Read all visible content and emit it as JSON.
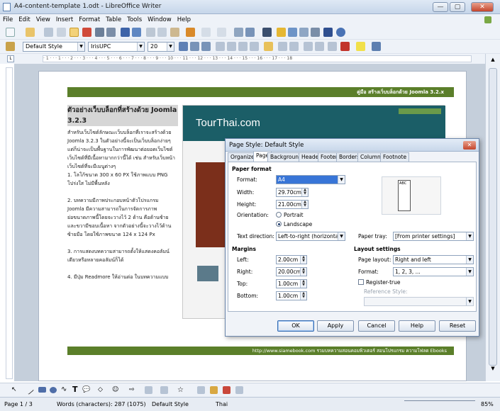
{
  "window": {
    "title": "A4-content-template 1.odt - LibreOffice Writer"
  },
  "menu": [
    "File",
    "Edit",
    "View",
    "Insert",
    "Format",
    "Table",
    "Tools",
    "Window",
    "Help"
  ],
  "format_toolbar": {
    "paragraph_style": "Default Style",
    "font_name": "IrisUPC",
    "font_size": "20"
  },
  "ruler": {
    "ticks": "· 1 · · · 1 · · · 2 · · · 3 · · · 4 · · · 5 · · · 6 · · · 7 · · · 8 · · · 9 · · · 10 · · · 11 · · · 12 · · · 13 · · · 14 · · · 15 · · · 16 · · · 17 · · · 18"
  },
  "document": {
    "header_text": "คู่มือ สร้างเว็บบล็อกด้วย Joomla 3.2.x",
    "heading": "ตัวอย่างเว็บบล็อกที่สร้างด้วย Joomla 3.2.3",
    "paragraphs": [
      "สำหรับเว็บไซต์ลักษณะเว็บบล็อกที่เราจะสร้างด้วย",
      "Joomla 3.2.3 ในตัวอย่างนี้จะเป็นเว็บบล็อกง่ายๆ",
      "แต่ก็น่าจะเป็นพื้นฐานในการพัฒนาต่อยอดเว็บไซต์",
      "เว็บไซต์ที่มีเนื้อหามากกว่านี้ได้ เช่น สำหรับเว็บหน้า",
      "เว็บไซต์ที่จะมีเมนูต่างๆ",
      "1. โลโก้ขนาด 300 x 60 PX ใช้ภาพแบบ PNG",
      "โปร่งใส ไม่มีพื้นหลัง",
      "",
      "2. บทความมีภาพประกอบหน้าตัวโปรแกรม",
      "Joomla มีความสามารถในการจัดการภาพ",
      "ย่อขนาดภาพนี้โดยจะวางไว้ 2 ด้าน คือด้านซ้าย",
      "และขวามีขอบเนื้อหา จากตัวอย่างนี้จะวางไว้ด้าน",
      "ซ้ายมือ โดยใช้ภาพขนาด 124 x 124 Px",
      "",
      "3. การแสดงบทความสามารถตั้งให้แสดงคอลัมน์",
      "เดียวหรือหลายคอลัมน์ก็ได้",
      "",
      "4. มีปุ่ม Readmore ให้อ่านต่อ ในบทความแบบ"
    ],
    "site_title": "TourThai.com",
    "footer_text": "http://www.siamebook.com รวมบทความสอนคอมพิวเตอร์ สอนโปรแกรม ความโฟลด Ebooks"
  },
  "dialog": {
    "title": "Page Style: Default Style",
    "tabs": [
      "Organizer",
      "Page",
      "Background",
      "Header",
      "Footer",
      "Borders",
      "Columns",
      "Footnote"
    ],
    "paper_format": {
      "section_label": "Paper format",
      "format_label": "Format:",
      "format_value": "A4",
      "width_label": "Width:",
      "width_value": "29.70cm",
      "height_label": "Height:",
      "height_value": "21.00cm",
      "orientation_label": "Orientation:",
      "portrait_label": "Portrait",
      "landscape_label": "Landscape",
      "text_direction_label": "Text direction:",
      "text_direction_value": "Left-to-right (horizontal)",
      "paper_tray_label": "Paper tray:",
      "paper_tray_value": "[From printer settings]",
      "preview_text": "ABC"
    },
    "margins": {
      "section_label": "Margins",
      "left_label": "Left:",
      "left_value": "2.00cm",
      "right_label": "Right:",
      "right_value": "20.00cm",
      "top_label": "Top:",
      "top_value": "1.00cm",
      "bottom_label": "Bottom:",
      "bottom_value": "1.00cm"
    },
    "layout_settings": {
      "section_label": "Layout settings",
      "page_layout_label": "Page layout:",
      "page_layout_value": "Right and left",
      "format_label": "Format:",
      "format_value": "1, 2, 3, ...",
      "register_true_label": "Register-true",
      "reference_style_label": "Reference Style:"
    },
    "buttons": {
      "ok": "OK",
      "apply": "Apply",
      "cancel": "Cancel",
      "help": "Help",
      "reset": "Reset"
    }
  },
  "status": {
    "page": "Page 1 / 3",
    "words": "Words (characters): 287 (1075)",
    "style": "Default Style",
    "language": "Thai",
    "zoom": "85%"
  }
}
